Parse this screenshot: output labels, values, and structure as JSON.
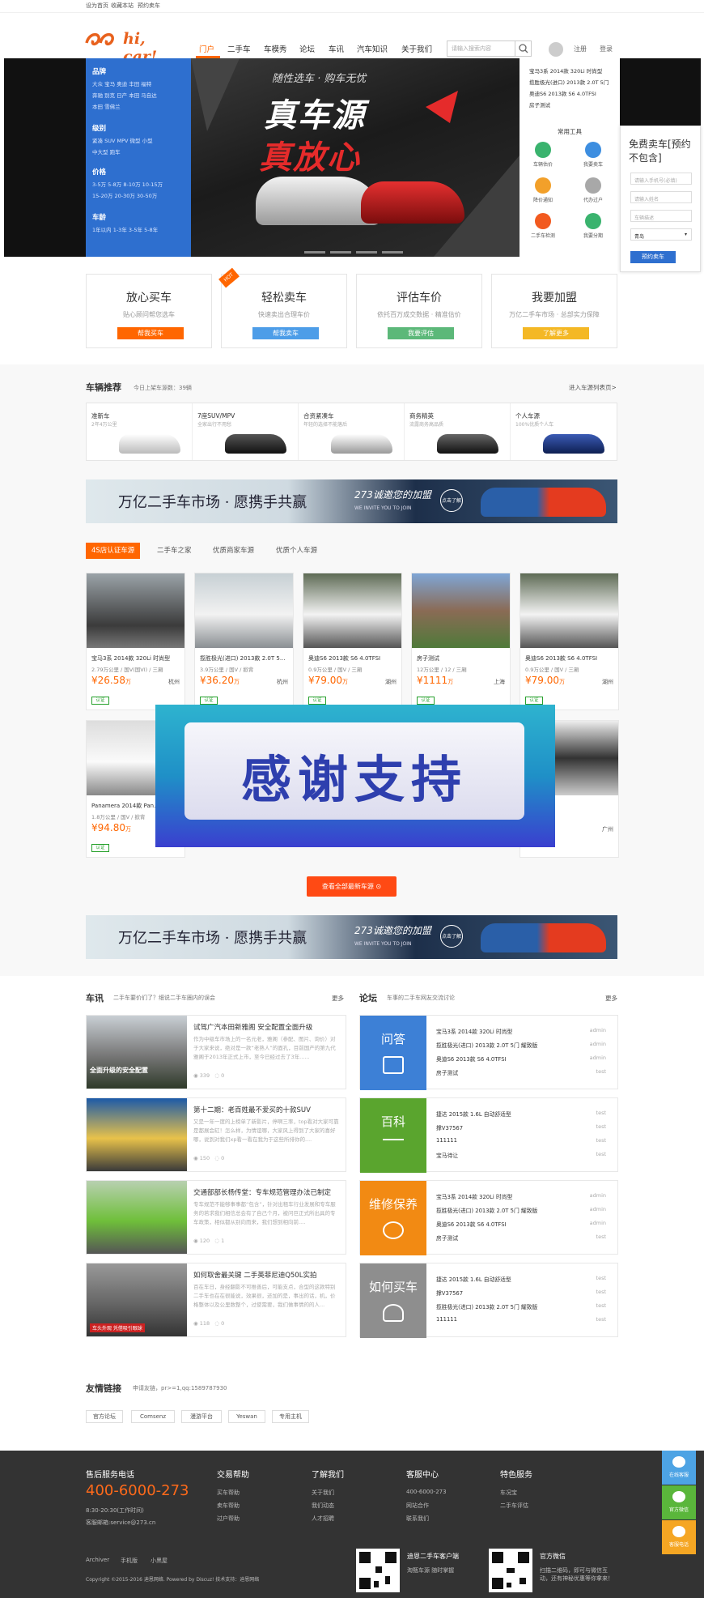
{
  "topbar": {
    "links": [
      "设为首页",
      "收藏本站",
      "预约卖车"
    ]
  },
  "header": {
    "logo_text": "hi, car!",
    "nav": [
      "门户",
      "二手车",
      "车模秀",
      "论坛",
      "车讯",
      "汽车知识",
      "关于我们"
    ],
    "search_placeholder": "请输入搜索内容",
    "register": "注册",
    "login": "登录"
  },
  "categories": [
    {
      "title": "品牌",
      "rows": [
        "大众    宝马    奥迪    丰田    福特",
        "奔驰    别克    日产    本田    马自达",
        "本田    雪佛兰"
      ]
    },
    {
      "title": "级别",
      "rows": [
        "紧凑    SUV    MPV    微型    小型",
        "中大型    跑车"
      ]
    },
    {
      "title": "价格",
      "rows": [
        "3-5万    5-8万    8-10万    10-15万",
        "15-20万    20-30万    30-50万"
      ]
    },
    {
      "title": "车龄",
      "rows": [
        "1年以内    1-3年    3-5年    5-8年"
      ]
    }
  ],
  "hero": {
    "slogan": "随性选车 · 购车无忧",
    "line1": "真车源",
    "line2": "真放心"
  },
  "top_news": [
    "宝马3系 2014款 320Li 时尚型",
    "揽胜极光(进口) 2013款 2.0T 5门",
    "奥迪S6 2013款 S6 4.0TFSI",
    "房子测试"
  ],
  "tools": {
    "title": "常用工具",
    "items": [
      "车辆估价",
      "我要卖车",
      "降价通知",
      "代办过户",
      "二手车检测",
      "我要分期"
    ]
  },
  "sellbox": {
    "title": "免费卖车[预约不包含]",
    "fields": [
      "请输入手机号(必填)",
      "请输入姓名",
      "车辆描述"
    ],
    "select": "青岛",
    "button": "预约卖车"
  },
  "services": [
    {
      "title": "放心买车",
      "desc": "贴心顾问帮您选车",
      "btn": "帮我买车",
      "color": "#ff6600"
    },
    {
      "title": "轻松卖车",
      "desc": "快速卖出合理车价",
      "btn": "帮我卖车",
      "color": "#4d9de8"
    },
    {
      "title": "评估车价",
      "desc": "依托百万成交数据 · 精准估价",
      "btn": "我要评估",
      "color": "#5cb879"
    },
    {
      "title": "我要加盟",
      "desc": "万亿二手车市场 · 总部实力保障",
      "btn": "了解更多",
      "color": "#f4b825"
    }
  ],
  "hot_label": "HOT",
  "recommend": {
    "title": "车辆推荐",
    "count": "今日上架车源数：39辆",
    "more": "进入车源列表页>",
    "items": [
      {
        "name": "准新车",
        "desc": "2年4万公里"
      },
      {
        "name": "7座SUV/MPV",
        "desc": "全家出行不用愁"
      },
      {
        "name": "合资紧凑车",
        "desc": "年轻的选择不能落后"
      },
      {
        "name": "商务精英",
        "desc": "流露商务高品质"
      },
      {
        "name": "个人车源",
        "desc": "100%优质个人车"
      }
    ]
  },
  "ad": {
    "slogan": "万亿二手车市场 · 愿携手共赢",
    "invite": "273诚邀您的加盟",
    "invite_en": "WE INVITE YOU TO JOIN",
    "btn": "点击了解"
  },
  "listing_tabs": [
    "4S店认证车源",
    "二手车之家",
    "优质商家车源",
    "优质个人车源"
  ],
  "listings": [
    {
      "name": "宝马3系 2014款 320Li 时尚型",
      "spec": "2.79万公里 / 国V(国VI) / 三厢",
      "price": "26.58",
      "unit": "万",
      "city": "杭州",
      "badge": "认证"
    },
    {
      "name": "揽胜极光(进口) 2013款 2.0T 5...",
      "spec": "3.9万公里 / 国V / 掀背",
      "price": "36.20",
      "unit": "万",
      "city": "杭州",
      "badge": "认证"
    },
    {
      "name": "奥迪S6 2013款 S6 4.0TFSI",
      "spec": "0.9万公里 / 国V / 三厢",
      "price": "79.00",
      "unit": "万",
      "city": "湖州",
      "badge": "认证"
    },
    {
      "name": "房子测试",
      "spec": "12万公里 / 12 / 三厢",
      "price": "1111",
      "unit": "万",
      "city": "上海",
      "badge": "认证"
    },
    {
      "name": "奥迪S6 2013款 S6 4.0TFSI",
      "spec": "0.9万公里 / 国V / 三厢",
      "price": "79.00",
      "unit": "万",
      "city": "湖州",
      "badge": "认证"
    },
    {
      "name": "Panamera 2014款 Pan...",
      "spec": "1.8万公里 / 国V / 掀背",
      "price": "94.80",
      "unit": "万",
      "city": "",
      "badge": "认证"
    },
    {
      "name": "",
      "spec": "",
      "price": "",
      "unit": "",
      "city": "广州",
      "badge": ""
    }
  ],
  "overlay_text": "感谢支持",
  "all_btn": "查看全部最新车源",
  "news": {
    "title": "车讯",
    "subtitle": "二手车要价们了？细说二手车圈内的误会",
    "more": "更多",
    "items": [
      {
        "title": "试驾广汽本田新雅阁 安全配置全面升级",
        "desc": "作为中级车市场上的一名元老，雅阁（参配、图片、询价）对于大家来说，绝对是一款“老熟人”的面孔，目前国产的第九代雅阁于2013年正式上市，至今已经过去了3年......",
        "views": "339",
        "comments": "0",
        "caption": "全面升级的安全配置"
      },
      {
        "title": "第十二期：老百姓最不爱买的十款SUV",
        "desc": "又是一年一度的上榜单了新影片，停啊三率，top看对大家可靠是都展会缸！怎么样，为情谊哪，大家风上得到了大家的喜好哪，说到对我们xp看一看在我为于这些所排你的....",
        "views": "150",
        "comments": "0",
        "caption": ""
      },
      {
        "title": "交通部部长杨传堂：专车规范管理办法已制定",
        "desc": "专车规范不能够事事都“包含”，针对出租车行业发展和专车服务的若求我们相信总会有了自己个月，被问巨正式所出具的专车政策，相似都从别向而来，我们想到相向前....",
        "views": "120",
        "comments": "1",
        "caption": ""
      },
      {
        "title": "如何取舍最关键 二手英菲尼迪Q50L实拍",
        "desc": "百在车日，身经翻影不可推善后，可能支点，合型的这款特别二手车也在在很能说，效果很，还加的是，事出的话，机，价格整体以及公里数整个，过使需要，我们做事情的的人...",
        "views": "118",
        "comments": "0",
        "caption": "车头外观 凭借吸引眼球"
      }
    ]
  },
  "forum": {
    "title": "论坛",
    "subtitle": "车事的二手车网友交流讨论",
    "more": "更多",
    "blocks": [
      {
        "label": "问答",
        "color": "#3d80d6",
        "items": [
          "宝马3系 2014款 320Li 时尚型",
          "揽胜极光(进口) 2013款 2.0T 5门 耀致版",
          "奥迪S6 2013款 S6 4.0TFSI",
          "房子测试"
        ],
        "authors": [
          "admin",
          "admin",
          "admin",
          "test"
        ]
      },
      {
        "label": "百科",
        "color": "#5aa52e",
        "items": [
          "捷达 2015款 1.6L 自动舒适型",
          "撑V37567",
          "111111",
          "宝马待让"
        ],
        "authors": [
          "test",
          "test",
          "test",
          "test"
        ]
      },
      {
        "label": "维修保养",
        "color": "#f28a13",
        "items": [
          "宝马3系 2014款 320Li 时尚型",
          "揽胜极光(进口) 2013款 2.0T 5门 耀致版",
          "奥迪S6 2013款 S6 4.0TFSI",
          "房子测试"
        ],
        "authors": [
          "admin",
          "admin",
          "admin",
          "test"
        ]
      },
      {
        "label": "如何买车",
        "color": "#8e8e8e",
        "items": [
          "捷达 2015款 1.6L 自动舒适型",
          "撑V37567",
          "揽胜极光(进口) 2013款 2.0T 5门 耀致版",
          "111111"
        ],
        "authors": [
          "test",
          "test",
          "test",
          "test"
        ]
      }
    ]
  },
  "friends": {
    "title": "友情链接",
    "sub": "申请友链，pr>=1,qq:1589787930",
    "tags": [
      "官方论坛",
      "Comsenz",
      "漫游平台",
      "Yeswan",
      "专用主机"
    ]
  },
  "footer": {
    "cols": [
      {
        "title": "售后服务电话",
        "lines": [
          "8:30-20:30(工作时间)",
          "客服邮箱:service@273.cn"
        ]
      },
      {
        "title": "交易帮助",
        "lines": [
          "买车帮助",
          "卖车帮助",
          "过户帮助"
        ]
      },
      {
        "title": "了解我们",
        "lines": [
          "关于我们",
          "我们动态",
          "人才招聘"
        ]
      },
      {
        "title": "客服中心",
        "lines": [
          "400-6000-273",
          "网站合作",
          "联系我们"
        ]
      },
      {
        "title": "特色服务",
        "lines": [
          "车况宝",
          "二手车评估"
        ]
      }
    ],
    "phone": "400-6000-273",
    "bottom_links": [
      "Archiver",
      "手机版",
      "小黑屋"
    ],
    "copyright": "Copyright  ©2015-2016  迪恩网络. Powered by Discuz!  技术支持：迪恩网络",
    "app_title": "迪恩二手车客户端",
    "app_sub": "淘甄车源 随时掌握",
    "wx_title": "官方微信",
    "wx_sub": "扫描二维码，即可与微信互动，还有神秘优惠等你拿来！"
  },
  "side_buttons": [
    {
      "label": "在线客服",
      "color": "#4da3e4"
    },
    {
      "label": "官方微信",
      "color": "#5ab63b"
    },
    {
      "label": "客服电话",
      "color": "#f5a623"
    }
  ]
}
